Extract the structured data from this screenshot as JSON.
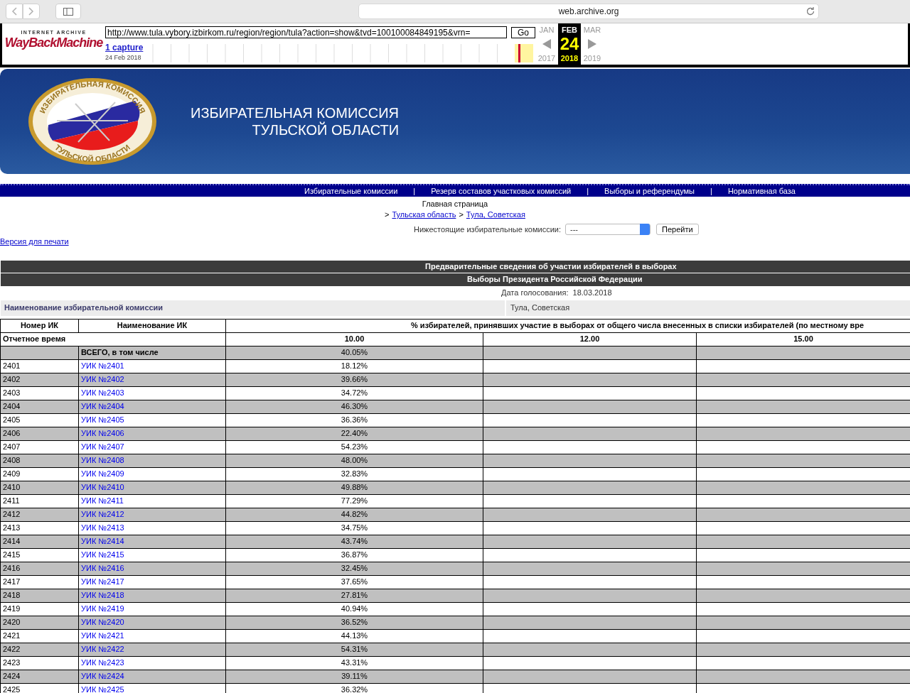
{
  "browser": {
    "address": "web.archive.org"
  },
  "wayback": {
    "logo_top": "INTERNET ARCHIVE",
    "logo_bottom": "WayBackMachine",
    "url": "http://www.tula.vybory.izbirkom.ru/region/region/tula?action=show&tvd=100100084849195&vrn=",
    "go": "Go",
    "captures": "1 capture",
    "capture_date": "24 Feb 2018",
    "months": [
      {
        "label": "JAN",
        "selected": false
      },
      {
        "label": "FEB",
        "selected": true
      },
      {
        "label": "MAR",
        "selected": false
      }
    ],
    "day": "24",
    "years": [
      {
        "label": "2017",
        "selected": false
      },
      {
        "label": "2018",
        "selected": true
      },
      {
        "label": "2019",
        "selected": false
      }
    ]
  },
  "banner": {
    "emblem_top": "ИЗБИРАТЕЛЬНАЯ КОМИССИЯ",
    "emblem_bottom": "ТУЛЬСКОЙ ОБЛАСТИ",
    "title_line1": "ИЗБИРАТЕЛЬНАЯ КОМИССИЯ",
    "title_line2": "ТУЛЬСКОЙ ОБЛАСТИ"
  },
  "nav": [
    "Избирательные комиссии",
    "Резерв составов участковых комиссий",
    "Выборы и референдумы",
    "Нормативная база"
  ],
  "nav_separator": "|",
  "breadcrumb": {
    "home": "Главная страница",
    "links": [
      "Тульская область",
      "Тула, Советская"
    ],
    "separator": ">"
  },
  "subcommissions": {
    "label": "Нижестоящие избирательные комиссии:",
    "value": "---",
    "button": "Перейти"
  },
  "print_link": "Версия для печати",
  "report": {
    "title": "Предварительные сведения об участии избирателей в выборах",
    "election": "Выборы Президента Российской Федерации",
    "date_label": "Дата голосования:",
    "date": "18.03.2018",
    "commission_label": "Наименование избирательной комиссии",
    "commission": "Тула, Советская"
  },
  "table": {
    "columns": [
      "Номер ИК",
      "Наименование ИК",
      "% избирателей, принявших участие в выборах от общего числа внесенных в списки избирателей (по местному вре"
    ],
    "time_label": "Отчетное время",
    "times": [
      "10.00",
      "12.00",
      "15.00"
    ],
    "total": {
      "name": "ВСЕГО, в том числе",
      "value": "40.05%"
    },
    "rows": [
      {
        "number": "2401",
        "name": "УИК №2401",
        "value": "18.12%"
      },
      {
        "number": "2402",
        "name": "УИК №2402",
        "value": "39.66%"
      },
      {
        "number": "2403",
        "name": "УИК №2403",
        "value": "34.72%"
      },
      {
        "number": "2404",
        "name": "УИК №2404",
        "value": "46.30%"
      },
      {
        "number": "2405",
        "name": "УИК №2405",
        "value": "36.36%"
      },
      {
        "number": "2406",
        "name": "УИК №2406",
        "value": "22.40%"
      },
      {
        "number": "2407",
        "name": "УИК №2407",
        "value": "54.23%"
      },
      {
        "number": "2408",
        "name": "УИК №2408",
        "value": "48.00%"
      },
      {
        "number": "2409",
        "name": "УИК №2409",
        "value": "32.83%"
      },
      {
        "number": "2410",
        "name": "УИК №2410",
        "value": "49.88%"
      },
      {
        "number": "2411",
        "name": "УИК №2411",
        "value": "77.29%"
      },
      {
        "number": "2412",
        "name": "УИК №2412",
        "value": "44.82%"
      },
      {
        "number": "2413",
        "name": "УИК №2413",
        "value": "34.75%"
      },
      {
        "number": "2414",
        "name": "УИК №2414",
        "value": "43.74%"
      },
      {
        "number": "2415",
        "name": "УИК №2415",
        "value": "36.87%"
      },
      {
        "number": "2416",
        "name": "УИК №2416",
        "value": "32.45%"
      },
      {
        "number": "2417",
        "name": "УИК №2417",
        "value": "37.65%"
      },
      {
        "number": "2418",
        "name": "УИК №2418",
        "value": "27.81%"
      },
      {
        "number": "2419",
        "name": "УИК №2419",
        "value": "40.94%"
      },
      {
        "number": "2420",
        "name": "УИК №2420",
        "value": "36.52%"
      },
      {
        "number": "2421",
        "name": "УИК №2421",
        "value": "44.13%"
      },
      {
        "number": "2422",
        "name": "УИК №2422",
        "value": "54.31%"
      },
      {
        "number": "2423",
        "name": "УИК №2423",
        "value": "43.31%"
      },
      {
        "number": "2424",
        "name": "УИК №2424",
        "value": "39.11%"
      },
      {
        "number": "2425",
        "name": "УИК №2425",
        "value": "36.32%"
      }
    ]
  }
}
